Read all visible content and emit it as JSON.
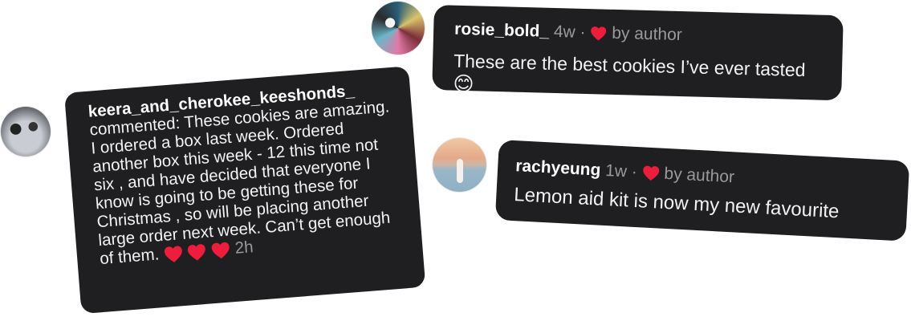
{
  "comments": [
    {
      "id": "rosie",
      "username": "rosie_bold_",
      "time": "4w",
      "separator": "·",
      "liked_label": "by author",
      "text": "These are the best cookies I’ve ever tasted",
      "emoji": "😊"
    },
    {
      "id": "keera",
      "username": "keera_and_cherokee_keeshonds_",
      "text": "commented: These cookies are amazing. I ordered a box last week. Ordered another box this week - 12 this time not six , and have decided that everyone I know is going to be getting these  for Christmas , so will be placing another large order next week. Can’t get enough of them.",
      "time": "2h"
    },
    {
      "id": "rachyeung",
      "username": "rachyeung",
      "time": "1w",
      "separator": "·",
      "liked_label": "by author",
      "text": "Lemon aid kit is now my new favourite"
    }
  ],
  "colors": {
    "card_bg": "#1f1f21",
    "heart": "#ee1d3c",
    "meta": "#9a9a9e"
  }
}
